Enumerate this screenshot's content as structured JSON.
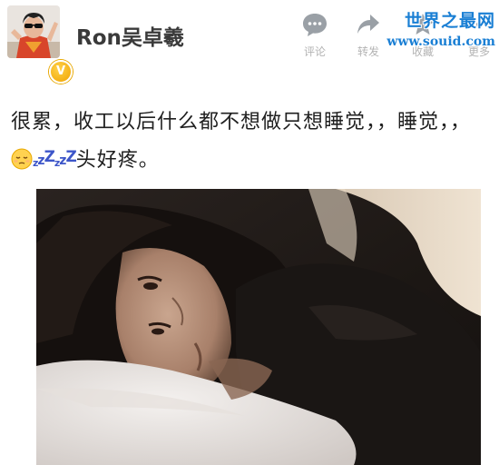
{
  "user": {
    "name": "Ron吴卓羲",
    "verified_badge": "V"
  },
  "actions": [
    {
      "label": "评论",
      "icon": "comment-icon"
    },
    {
      "label": "转发",
      "icon": "repost-icon"
    },
    {
      "label": "收藏",
      "icon": "favorite-icon"
    },
    {
      "label": "更多",
      "icon": "more-icon"
    }
  ],
  "watermark": {
    "title": "世界之最网",
    "url": "www.souid.com"
  },
  "post": {
    "text_before_emoji": "很累，收工以后什么都不想做只想睡觉，，睡觉，，",
    "emoji": "sleepy-face-icon",
    "zzz": [
      "z",
      "z",
      "Z",
      "z",
      "z",
      "Z"
    ],
    "text_after_emoji": "头好疼。"
  },
  "colors": {
    "watermark_blue": "#1a7fd4",
    "action_gray": "#b3b3b3",
    "verified_gold": "#f0a300",
    "zzz_blue": "#3d56c9"
  }
}
